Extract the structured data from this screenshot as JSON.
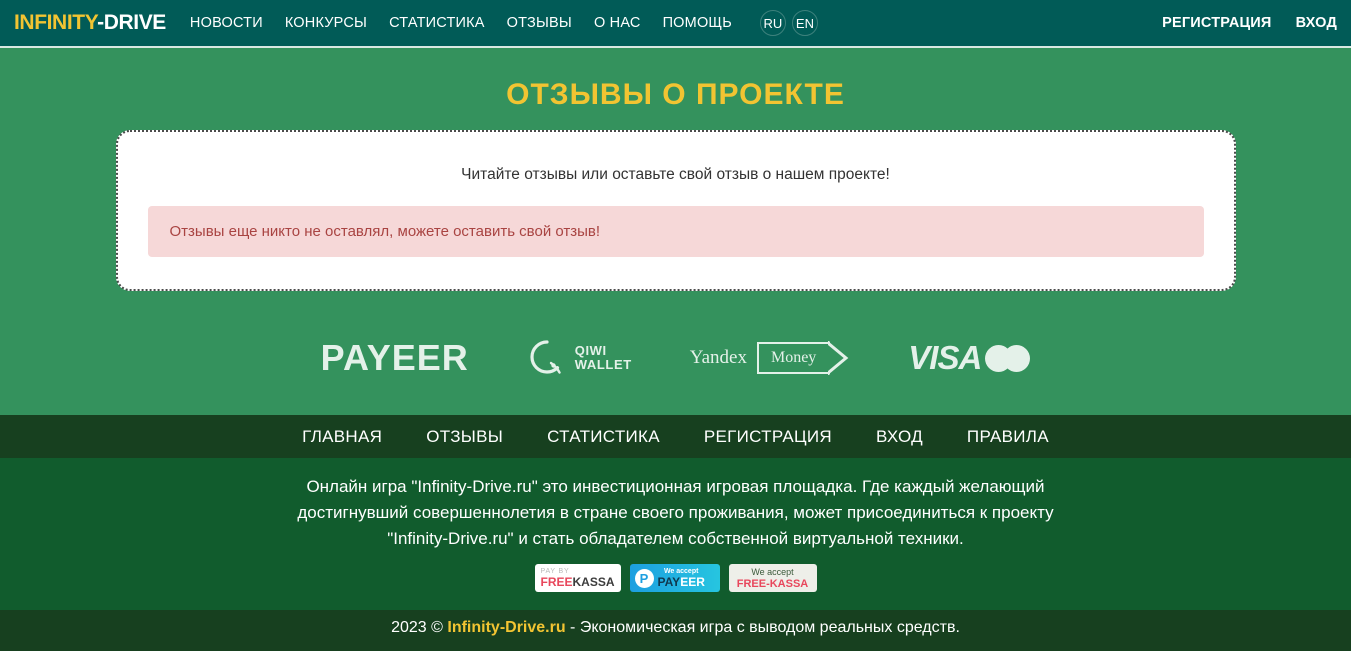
{
  "navbar": {
    "brand_part1": "INFINITY",
    "brand_part2": "-DRIVE",
    "links": [
      {
        "label": "НОВОСТИ",
        "name": "nav-news"
      },
      {
        "label": "КОНКУРСЫ",
        "name": "nav-contests"
      },
      {
        "label": "СТАТИСТИКА",
        "name": "nav-statistics"
      },
      {
        "label": "ОТЗЫВЫ",
        "name": "nav-reviews"
      },
      {
        "label": "О НАС",
        "name": "nav-about"
      },
      {
        "label": "ПОМОЩЬ",
        "name": "nav-help"
      }
    ],
    "lang_ru": "RU",
    "lang_en": "EN",
    "register": "РЕГИСТРАЦИЯ",
    "login": "ВХОД"
  },
  "page": {
    "title": "ОТЗЫВЫ О ПРОЕКТЕ",
    "intro": "Читайте отзывы или оставьте свой отзыв о нашем проекте!",
    "alert": "Отзывы еще никто не оставлял, можете оставить свой отзыв!"
  },
  "payments": {
    "payeer": "PAYEER",
    "qiwi_line1": "QIWI",
    "qiwi_line2": "WALLET",
    "yandex": "Yandex",
    "yandex_money": "Money",
    "visa": "VISA"
  },
  "footer_nav": [
    {
      "label": "ГЛАВНАЯ",
      "name": "footer-nav-home"
    },
    {
      "label": "ОТЗЫВЫ",
      "name": "footer-nav-reviews"
    },
    {
      "label": "СТАТИСТИКА",
      "name": "footer-nav-statistics"
    },
    {
      "label": "РЕГИСТРАЦИЯ",
      "name": "footer-nav-register"
    },
    {
      "label": "ВХОД",
      "name": "footer-nav-login"
    },
    {
      "label": "ПРАВИЛА",
      "name": "footer-nav-rules"
    }
  ],
  "description": {
    "line1": "Онлайн игра \"Infinity-Drive.ru\" это инвестиционная игровая площадка. Где каждый желающий",
    "line2": "достигнувший совершеннолетия в стране своего проживания, может присоединиться к проекту",
    "line3": "\"Infinity-Drive.ru\" и стать обладателем собственной виртуальной техники."
  },
  "badges": {
    "freekassa_top": "PAY BY",
    "freekassa_free": "FREE",
    "freekassa_kassa": "KASSA",
    "payeer_top": "We accept",
    "payeer_pay": "PAY",
    "payeer_eer": "EER",
    "payeer_mark": "P",
    "freekassa2_top": "We accept",
    "freekassa2_name": "FREE-KASSA"
  },
  "copyright": {
    "prefix": "2023 © ",
    "link": "Infinity-Drive.ru",
    "suffix": " - Экономическая игра с выводом реальных средств."
  },
  "colors": {
    "navbar_bg": "#015B57",
    "body_green": "#34925d",
    "brand_gold": "#f2c432",
    "dark_band": "#17401f",
    "desc_band": "#115c2d",
    "alert_bg": "#f6d8d8",
    "alert_text": "#a94442"
  }
}
